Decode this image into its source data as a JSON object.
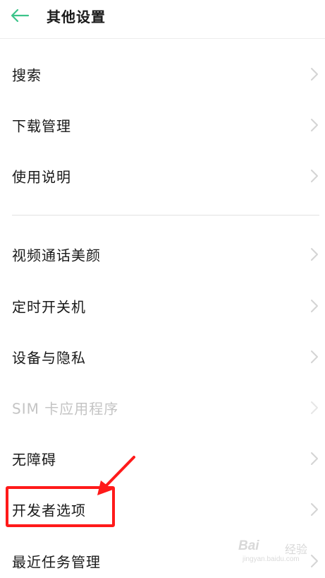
{
  "header": {
    "title": "其他设置",
    "back_icon": "arrow-left-icon",
    "accent_color": "#3cc48a"
  },
  "settings_groups": [
    {
      "items": [
        {
          "label": "搜索",
          "enabled": true
        },
        {
          "label": "下载管理",
          "enabled": true
        },
        {
          "label": "使用说明",
          "enabled": true
        }
      ]
    },
    {
      "items": [
        {
          "label": "视频通话美颜",
          "enabled": true
        },
        {
          "label": "定时开关机",
          "enabled": true
        },
        {
          "label": "设备与隐私",
          "enabled": true
        },
        {
          "label": "SIM 卡应用程序",
          "enabled": false
        },
        {
          "label": "无障碍",
          "enabled": true
        },
        {
          "label": "开发者选项",
          "enabled": true,
          "highlighted": true
        },
        {
          "label": "最近任务管理",
          "enabled": true
        }
      ]
    }
  ],
  "annotation": {
    "color": "#ff1a1a",
    "target": "开发者选项"
  },
  "watermark": {
    "brand": "Bai",
    "brand_suffix": "经验",
    "url": "jingyan.baidu.com"
  }
}
